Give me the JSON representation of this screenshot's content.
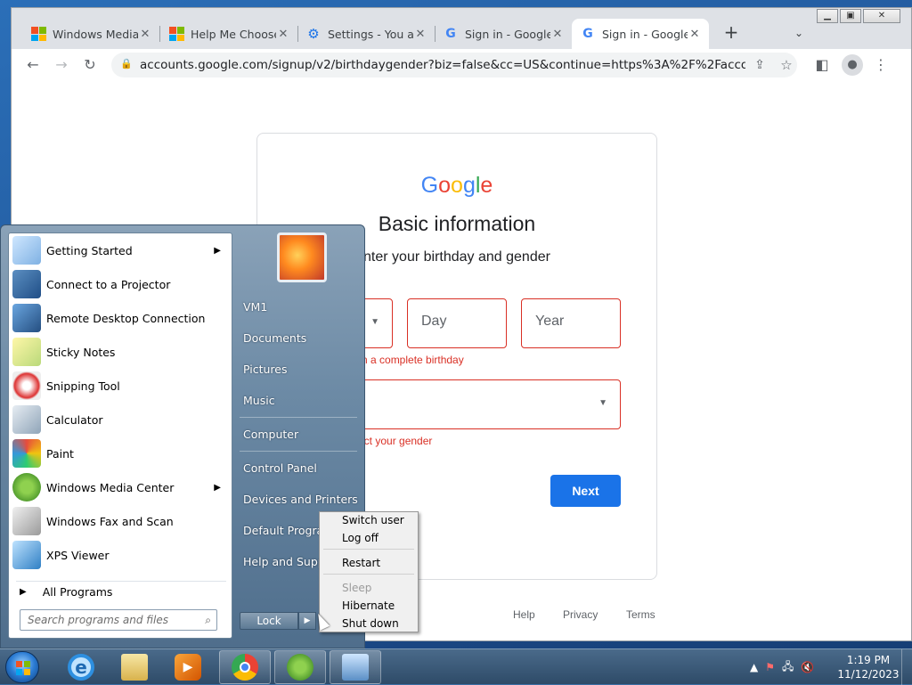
{
  "browser": {
    "tabs": [
      {
        "title": "Windows Media",
        "favicon": "microsoft-logo-icon"
      },
      {
        "title": "Help Me Choose",
        "favicon": "microsoft-logo-icon"
      },
      {
        "title": "Settings - You ar",
        "favicon": "gear-icon"
      },
      {
        "title": "Sign in - Google",
        "favicon": "google-g-icon"
      },
      {
        "title": "Sign in - Google",
        "favicon": "google-g-icon"
      }
    ],
    "active_tab": 4,
    "new_tab": "+",
    "tab_list": "⌄",
    "url": "accounts.google.com/signup/v2/birthdaygender?biz=false&cc=US&continue=https%3A%2F%2Faccounts.g...",
    "window_buttons": {
      "minimize": "▁",
      "maximize": "▣",
      "close": "✕"
    }
  },
  "google_form": {
    "logo": [
      "G",
      "o",
      "o",
      "g",
      "l",
      "e"
    ],
    "title": "Basic information",
    "subtitle": "nter your birthday and gender",
    "month_placeholder": "",
    "day_placeholder": "Day",
    "year_placeholder": "Year",
    "birthday_error": "n a complete birthday",
    "gender_error": "ect your gender",
    "next_label": "Next",
    "footer": {
      "help": "Help",
      "privacy": "Privacy",
      "terms": "Terms"
    },
    "error_color": "#d93025",
    "accent_color": "#1a73e8"
  },
  "start_menu": {
    "programs": [
      {
        "label": "Getting Started",
        "icon": "getting-started-icon",
        "has_submenu": true
      },
      {
        "label": "Connect to a Projector",
        "icon": "projector-icon",
        "has_submenu": false
      },
      {
        "label": "Remote Desktop Connection",
        "icon": "remote-desktop-icon",
        "has_submenu": false
      },
      {
        "label": "Sticky Notes",
        "icon": "sticky-notes-icon",
        "has_submenu": false
      },
      {
        "label": "Snipping Tool",
        "icon": "snipping-tool-icon",
        "has_submenu": false
      },
      {
        "label": "Calculator",
        "icon": "calculator-icon",
        "has_submenu": false
      },
      {
        "label": "Paint",
        "icon": "paint-icon",
        "has_submenu": false
      },
      {
        "label": "Windows Media Center",
        "icon": "media-center-icon",
        "has_submenu": true
      },
      {
        "label": "Windows Fax and Scan",
        "icon": "fax-scan-icon",
        "has_submenu": false
      },
      {
        "label": "XPS Viewer",
        "icon": "xps-viewer-icon",
        "has_submenu": false
      }
    ],
    "all_programs": "All Programs",
    "search_placeholder": "Search programs and files",
    "right_links": [
      "VM1",
      "Documents",
      "Pictures",
      "Music",
      "Computer",
      "Control Panel",
      "Devices and Printers",
      "Default Programs",
      "Help and Support"
    ],
    "lock_label": "Lock",
    "lock_arrow": "▶"
  },
  "power_menu": {
    "items": [
      {
        "label": "Switch user",
        "disabled": false
      },
      {
        "label": "Log off",
        "disabled": false
      },
      {
        "label": "Restart",
        "disabled": false
      },
      {
        "label": "Sleep",
        "disabled": true
      },
      {
        "label": "Hibernate",
        "disabled": false
      },
      {
        "label": "Shut down",
        "disabled": false
      }
    ]
  },
  "taskbar": {
    "apps": [
      "internet-explorer-icon",
      "windows-explorer-icon",
      "media-player-icon",
      "chrome-icon",
      "media-center-icon",
      "remote-app-icon"
    ],
    "time": "1:19 PM",
    "date": "11/12/2023"
  }
}
